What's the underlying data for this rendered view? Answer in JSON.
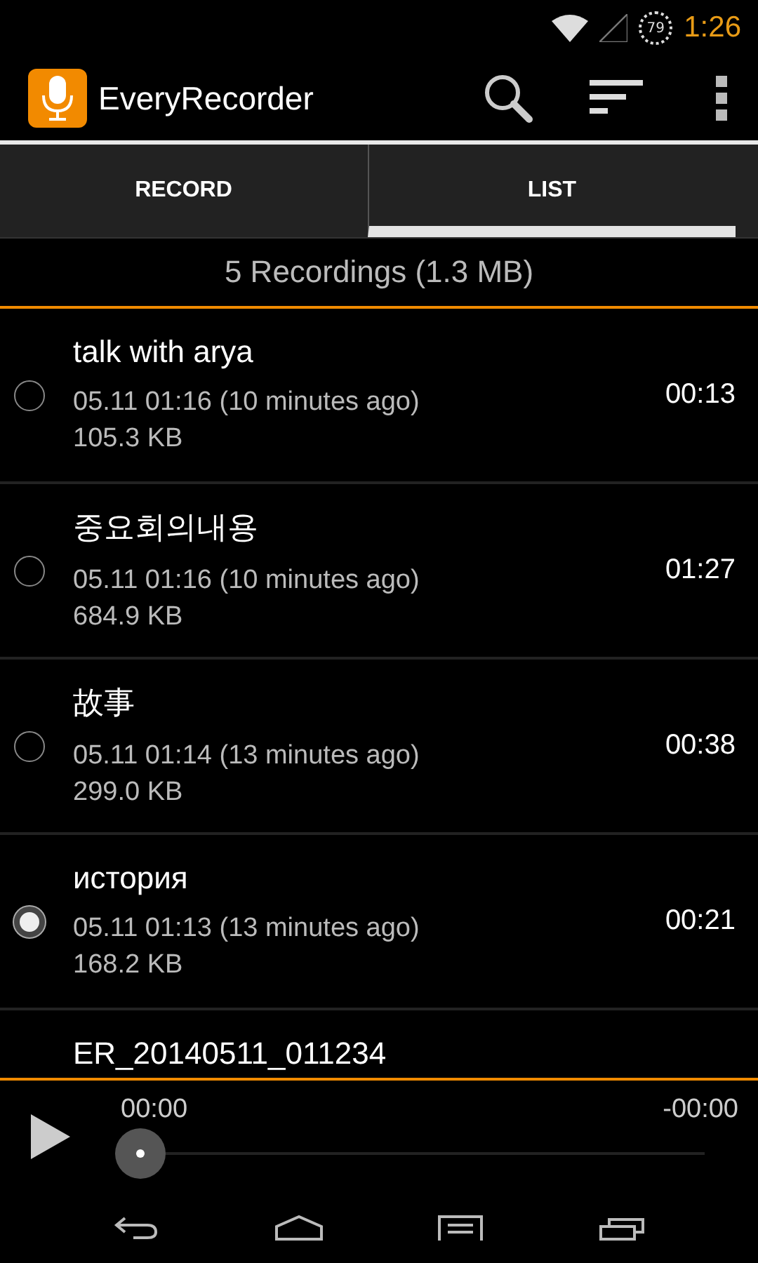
{
  "status_bar": {
    "battery": "79",
    "time": "1:26"
  },
  "action_bar": {
    "title": "EveryRecorder"
  },
  "tabs": [
    {
      "label": "RECORD",
      "selected": false
    },
    {
      "label": "LIST",
      "selected": true
    }
  ],
  "summary": "5 Recordings (1.3 MB)",
  "recordings": [
    {
      "name": "talk with arya",
      "date": "05.11 01:16 (10 minutes ago)",
      "size": "105.3 KB",
      "duration": "00:13",
      "selected": false
    },
    {
      "name": "중요회의내용",
      "date": "05.11 01:16 (10 minutes ago)",
      "size": "684.9 KB",
      "duration": "01:27",
      "selected": false
    },
    {
      "name": "故事",
      "date": "05.11 01:14 (13 minutes ago)",
      "size": "299.0 KB",
      "duration": "00:38",
      "selected": false
    },
    {
      "name": "история",
      "date": "05.11 01:13 (13 minutes ago)",
      "size": "168.2 KB",
      "duration": "00:21",
      "selected": true
    },
    {
      "name": "ER_20140511_011234"
    }
  ],
  "player": {
    "elapsed": "00:00",
    "remaining": "-00:00"
  }
}
